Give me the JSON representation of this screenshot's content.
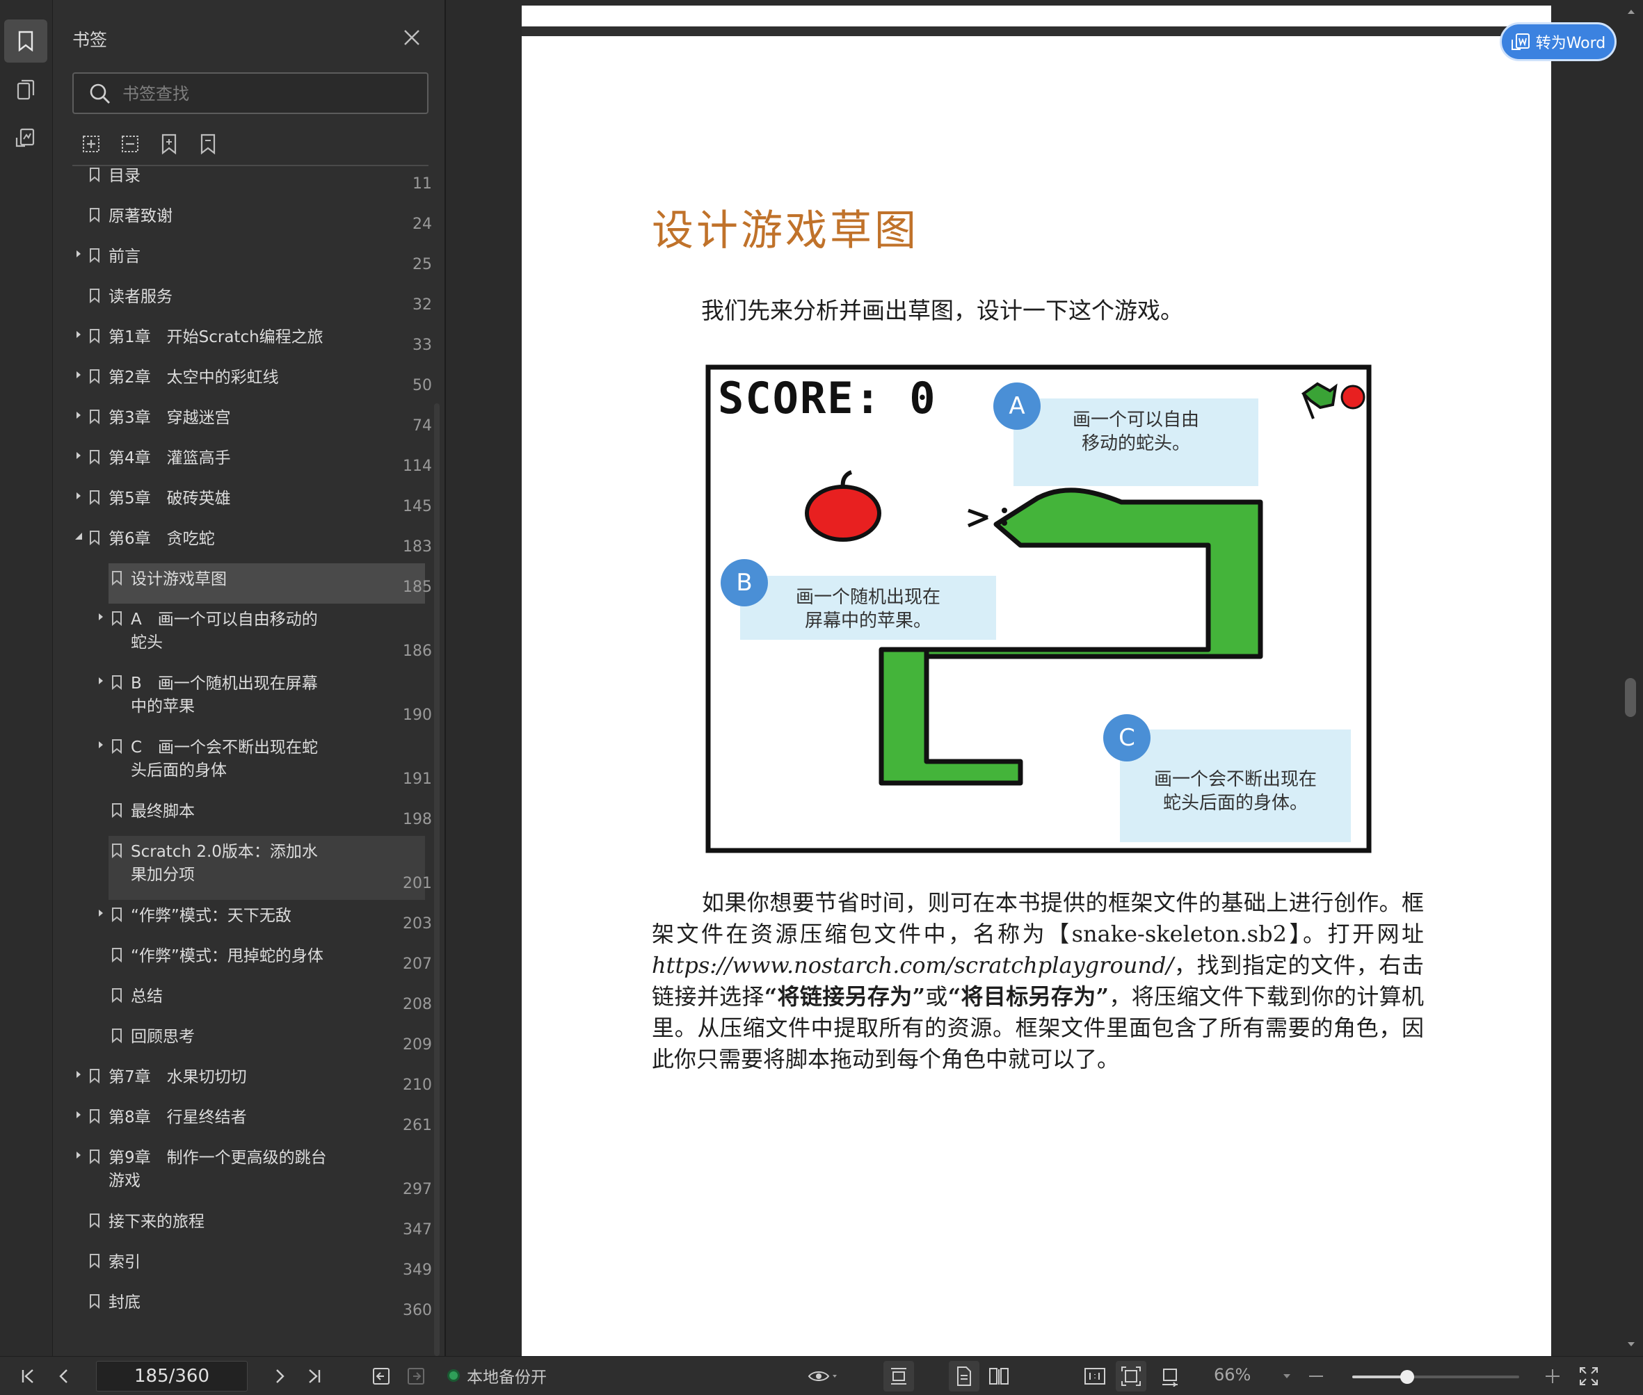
{
  "panel": {
    "title": "书签",
    "search_placeholder": "书签查找"
  },
  "bookmarks": [
    {
      "label": "目录",
      "page": "11",
      "level": 0,
      "arrow": "none"
    },
    {
      "label": "原著致谢",
      "page": "24",
      "level": 0,
      "arrow": "none"
    },
    {
      "label": "前言",
      "page": "25",
      "level": 0,
      "arrow": "right"
    },
    {
      "label": "读者服务",
      "page": "32",
      "level": 0,
      "arrow": "none"
    },
    {
      "label": "第1章　开始Scratch编程之旅",
      "page": "33",
      "level": 0,
      "arrow": "right"
    },
    {
      "label": "第2章　太空中的彩虹线",
      "page": "50",
      "level": 0,
      "arrow": "right"
    },
    {
      "label": "第3章　穿越迷宫",
      "page": "74",
      "level": 0,
      "arrow": "right"
    },
    {
      "label": "第4章　灌篮高手",
      "page": "114",
      "level": 0,
      "arrow": "right"
    },
    {
      "label": "第5章　破砖英雄",
      "page": "145",
      "level": 0,
      "arrow": "right"
    },
    {
      "label": "第6章　贪吃蛇",
      "page": "183",
      "level": 0,
      "arrow": "down"
    },
    {
      "label": "设计游戏草图",
      "page": "185",
      "level": 1,
      "arrow": "none",
      "state": "sel"
    },
    {
      "label": "A　画一个可以自由移动的\n蛇头",
      "page": "186",
      "level": 1,
      "arrow": "right"
    },
    {
      "label": "B　画一个随机出现在屏幕\n中的苹果",
      "page": "190",
      "level": 1,
      "arrow": "right"
    },
    {
      "label": "C　画一个会不断出现在蛇\n头后面的身体",
      "page": "191",
      "level": 1,
      "arrow": "right"
    },
    {
      "label": "最终脚本",
      "page": "198",
      "level": 1,
      "arrow": "none"
    },
    {
      "label": "Scratch 2.0版本：添加水\n果加分项",
      "page": "201",
      "level": 1,
      "arrow": "none",
      "state": "hl"
    },
    {
      "label": "“作弊”模式：天下无敌",
      "page": "203",
      "level": 1,
      "arrow": "right"
    },
    {
      "label": "“作弊”模式：甩掉蛇的身体",
      "page": "207",
      "level": 1,
      "arrow": "none"
    },
    {
      "label": "总结",
      "page": "208",
      "level": 1,
      "arrow": "none"
    },
    {
      "label": "回顾思考",
      "page": "209",
      "level": 1,
      "arrow": "none"
    },
    {
      "label": "第7章　水果切切切",
      "page": "210",
      "level": 0,
      "arrow": "right"
    },
    {
      "label": "第8章　行星终结者",
      "page": "261",
      "level": 0,
      "arrow": "right"
    },
    {
      "label": "第9章　制作一个更高级的跳台\n游戏",
      "page": "297",
      "level": 0,
      "arrow": "right"
    },
    {
      "label": "接下来的旅程",
      "page": "347",
      "level": 0,
      "arrow": "none"
    },
    {
      "label": "索引",
      "page": "349",
      "level": 0,
      "arrow": "none"
    },
    {
      "label": "封底",
      "page": "360",
      "level": 0,
      "arrow": "none"
    }
  ],
  "document": {
    "heading": "设计游戏草图",
    "intro": "我们先来分析并画出草图，设计一下这个游戏。",
    "figure": {
      "score": "SCORE: 0",
      "A_letter": "A",
      "A_text": "画一个可以自由\n移动的蛇头。",
      "B_letter": "B",
      "B_text": "画一个随机出现在\n屏幕中的苹果。",
      "C_letter": "C",
      "C_text": "画一个会不断出现在\n蛇头后面的身体。"
    },
    "body_1": "如果你想要节省时间，则可在本书提供的框架文件的基础上进行创作。框架文件在资源压缩包文件中，名称为【snake-skeleton.sb2】。打开网址",
    "body_url": "https://www.nostarch.com/scratchplayground/",
    "body_2": "，找到指定的文件，右击链接并选择",
    "body_bold_1": "“将链接另存为”",
    "body_3": "或",
    "body_bold_2": "“将目标另存为”",
    "body_4": "，将压缩文件下载到你的计算机里。从压缩文件中提取所有的资源。框架文件里面包含了所有需要的角色，因此你只需要将脚本拖动到每个角色中就可以了。"
  },
  "toword_label": "转为Word",
  "status": {
    "page_indicator": "185/360",
    "backup_label": "本地备份开",
    "zoom_label": "66%",
    "zoom_fraction": 0.33,
    "backup_color": "#2f9e58"
  },
  "colors": {
    "heading": "#c0722a",
    "accent": "#3b82e0",
    "snake": "#44b43a",
    "apple": "#e82020"
  }
}
